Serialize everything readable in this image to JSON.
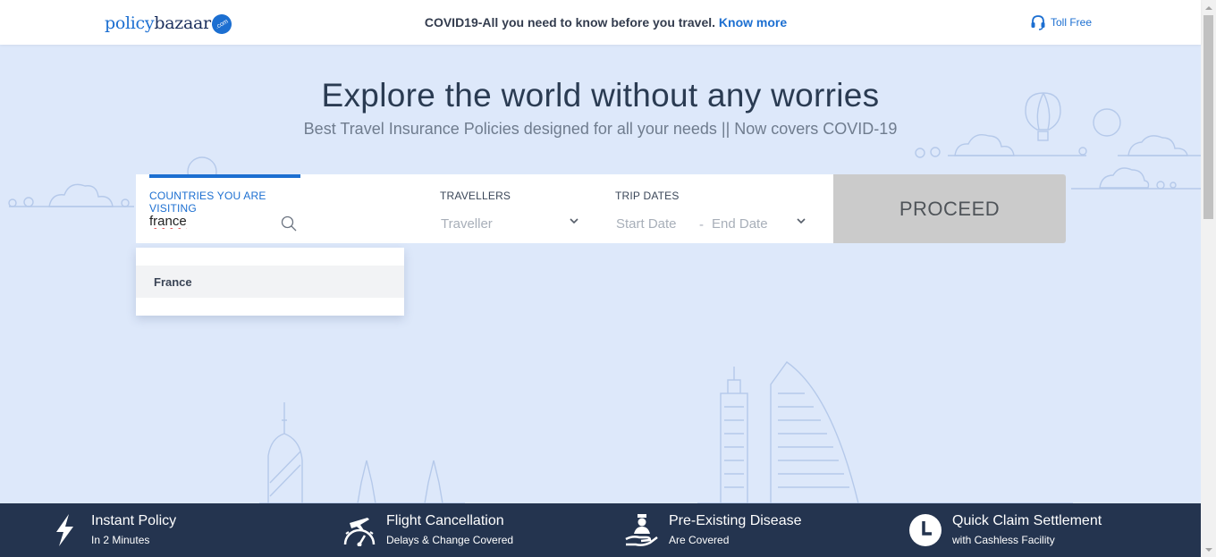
{
  "header": {
    "logo": {
      "part1": "policy",
      "part2": "bazaar",
      "badge": ".com"
    },
    "announcement": "COVID19-All you need to know before you travel.",
    "announcement_link": "Know more",
    "toll_free": "Toll Free",
    "toll_free_icon": "headset-icon"
  },
  "hero": {
    "title": "Explore the world without any worries",
    "subtitle": "Best Travel Insurance Policies designed for all your needs || Now covers COVID-19"
  },
  "form": {
    "countries_label": "COUNTRIES YOU ARE VISITING",
    "countries_value": "france",
    "travellers_label": "TRAVELLERS",
    "travellers_placeholder": "Traveller",
    "dates_label": "TRIP DATES",
    "start_date_placeholder": "Start Date",
    "date_separator": "-",
    "end_date_placeholder": "End Date",
    "proceed_label": "PROCEED"
  },
  "dropdown": {
    "options": [
      "France"
    ]
  },
  "features": [
    {
      "title": "Instant Policy",
      "subtitle": "In 2 Minutes",
      "icon": "lightning-icon"
    },
    {
      "title": "Flight Cancellation",
      "subtitle": "Delays & Change Covered",
      "icon": "plane-gauge-icon"
    },
    {
      "title": "Pre-Existing Disease",
      "subtitle": "Are Covered",
      "icon": "medical-care-icon"
    },
    {
      "title": "Quick Claim Settlement",
      "subtitle": "with Cashless Facility",
      "icon": "clock-icon"
    }
  ],
  "colors": {
    "brand_blue": "#1c6fd1",
    "background": "#dde8fa",
    "footer": "#24344f",
    "proceed_disabled": "#cbcbcb"
  }
}
